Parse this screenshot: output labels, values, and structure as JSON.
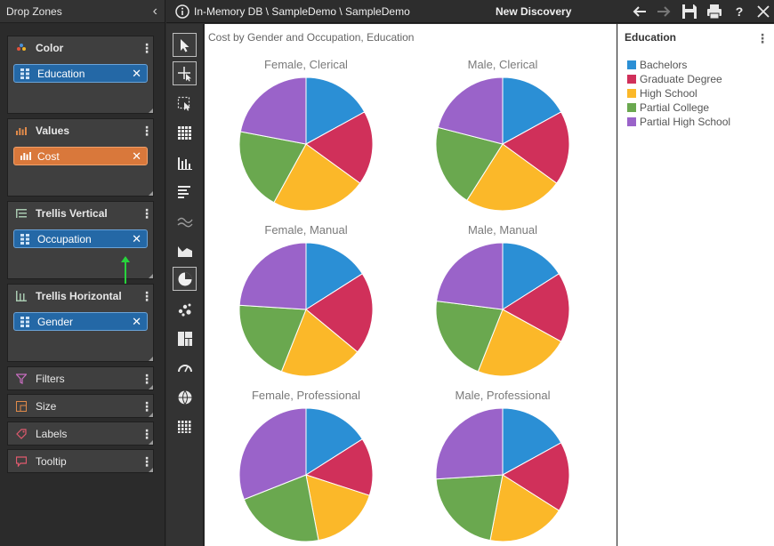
{
  "drop_zones": {
    "title": "Drop Zones",
    "color": {
      "label": "Color",
      "pill": "Education"
    },
    "values": {
      "label": "Values",
      "pill": "Cost"
    },
    "trellis_vertical": {
      "label": "Trellis Vertical",
      "pill": "Occupation"
    },
    "trellis_horizontal": {
      "label": "Trellis Horizontal",
      "pill": "Gender"
    },
    "filters": {
      "label": "Filters"
    },
    "size": {
      "label": "Size"
    },
    "labels": {
      "label": "Labels"
    },
    "tooltip": {
      "label": "Tooltip"
    }
  },
  "topbar": {
    "path": "In-Memory DB \\ SampleDemo \\ SampleDemo",
    "discovery": "New Discovery"
  },
  "colors": {
    "Bachelors": "#2b8fd5",
    "Graduate Degree": "#d0305a",
    "High School": "#fbb829",
    "Partial College": "#6aa84f",
    "Partial High School": "#9a63c9",
    "pill_blue": "#2468a6",
    "pill_orange": "#d9783b"
  },
  "legend": {
    "title": "Education",
    "items": [
      "Bachelors",
      "Graduate Degree",
      "High School",
      "Partial College",
      "Partial High School"
    ]
  },
  "chart_data": {
    "type": "pie",
    "title": "Cost by Gender and Occupation, Education",
    "categories": [
      "Bachelors",
      "Graduate Degree",
      "High School",
      "Partial College",
      "Partial High School"
    ],
    "panels": [
      {
        "title": "Female, Clerical",
        "values": [
          17,
          18,
          23,
          20,
          22
        ]
      },
      {
        "title": "Male, Clerical",
        "values": [
          17,
          18,
          24,
          20,
          21
        ]
      },
      {
        "title": "Female, Manual",
        "values": [
          16,
          20,
          20,
          20,
          24
        ]
      },
      {
        "title": "Male, Manual",
        "values": [
          16,
          17,
          23,
          21,
          23
        ]
      },
      {
        "title": "Female, Professional",
        "values": [
          16,
          14,
          17,
          22,
          31
        ]
      },
      {
        "title": "Male, Professional",
        "values": [
          17,
          17,
          19,
          21,
          26
        ]
      }
    ]
  }
}
